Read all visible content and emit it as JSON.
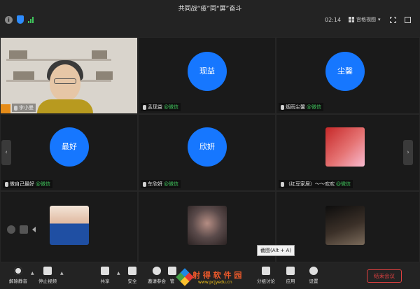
{
  "window": {
    "title": "共同战“疫”同“屏”奋斗",
    "timer": "02:14",
    "view_mode": "宫格视图"
  },
  "participants": [
    {
      "name": "李小曼",
      "type": "video"
    },
    {
      "name": "孟现益",
      "suffix": "@微信",
      "avatar_text": "现益",
      "type": "avatar"
    },
    {
      "name": "烟雨尘馨",
      "suffix": "@微信",
      "avatar_text": "尘馨",
      "type": "avatar"
    },
    {
      "name": "做自己最好",
      "suffix": "@微信",
      "avatar_text": "最好",
      "type": "avatar"
    },
    {
      "name": "车欣妍",
      "suffix": "@微信",
      "avatar_text": "欣妍",
      "type": "avatar"
    },
    {
      "name": "（红豆家居）～～欢欢",
      "suffix": "@微信",
      "type": "photo"
    },
    {
      "name": "",
      "type": "photo"
    },
    {
      "name": "",
      "type": "photo"
    },
    {
      "name": "",
      "type": "photo"
    }
  ],
  "tooltip": "截图(Alt + A)",
  "toolbar": {
    "items": [
      {
        "label": "解除静音",
        "icon": "mic-muted-icon"
      },
      {
        "label": "停止视频",
        "icon": "video-icon"
      },
      {
        "label": "共享",
        "icon": "share-screen-icon"
      },
      {
        "label": "安全",
        "icon": "shield-icon"
      },
      {
        "label": "邀请参会",
        "icon": "invite-icon"
      },
      {
        "label": "管",
        "icon": "manage-icon"
      },
      {
        "label": "分组讨论",
        "icon": "breakout-icon"
      },
      {
        "label": "应用",
        "icon": "apps-icon"
      },
      {
        "label": "设置",
        "icon": "gear-icon"
      }
    ],
    "end_label": "结束会议"
  },
  "watermark": {
    "main": "射 得 软 件 园",
    "url": "www.pcjyedu.cn"
  },
  "colors": {
    "avatar": "#1677ff",
    "wechat": "#3fc35b",
    "end": "#e04040"
  }
}
